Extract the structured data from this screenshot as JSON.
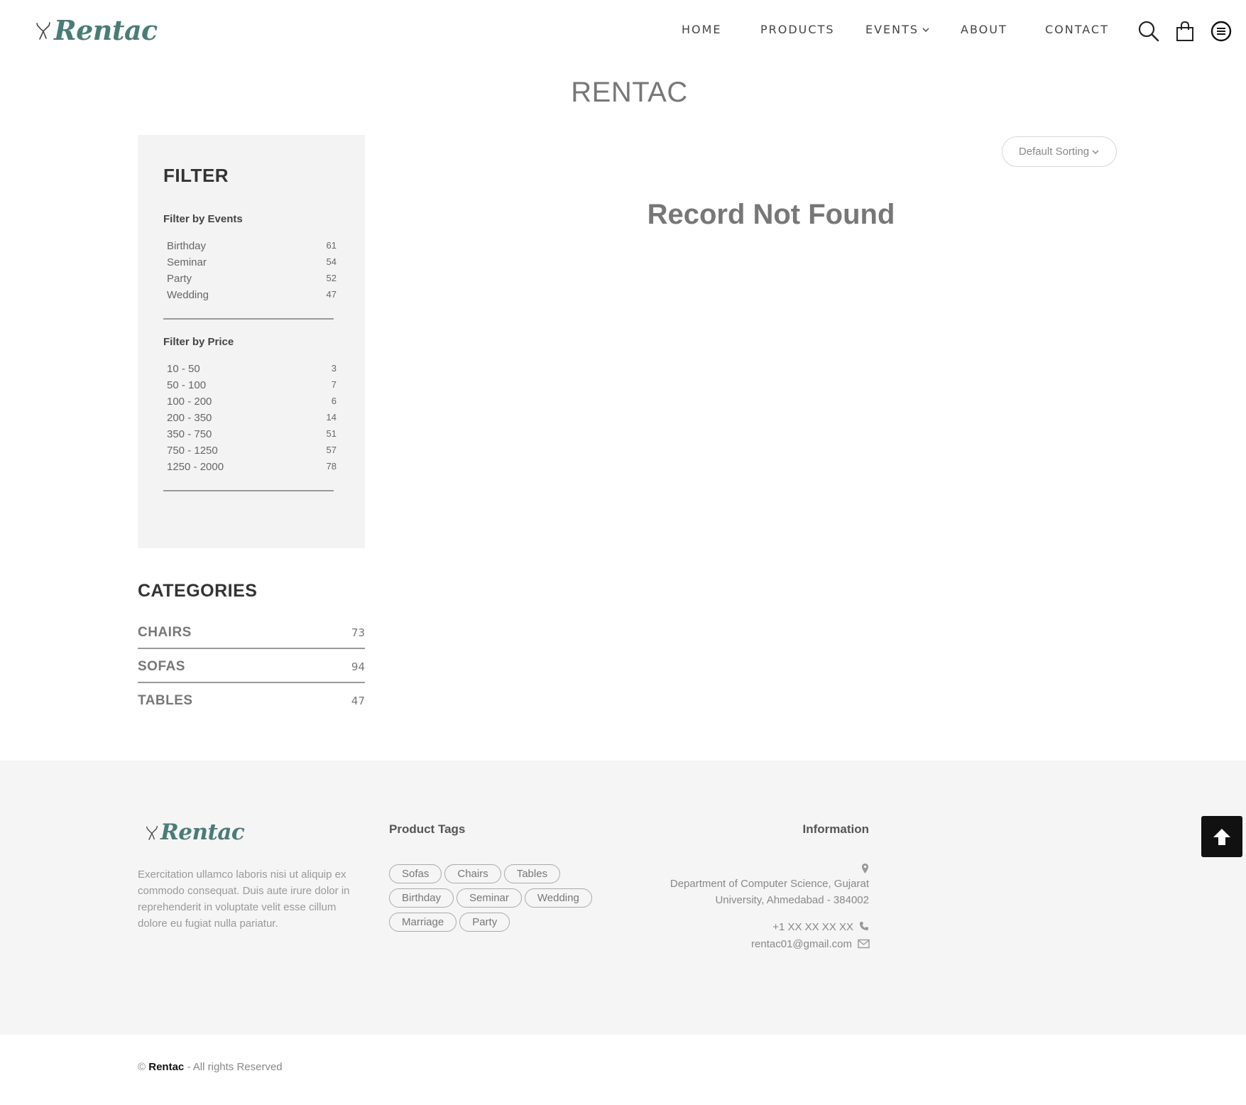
{
  "brand": {
    "name": "Rentac",
    "color": "#4a7c78"
  },
  "nav": {
    "home": "HOME",
    "products": "PRODUCTS",
    "events": "EVENTS",
    "about": "ABOUT",
    "contact": "CONTACT",
    "icons": [
      "search-icon",
      "shopping-bag-icon",
      "menu-icon"
    ]
  },
  "page": {
    "title": "RENTAC",
    "sort_label": "Default Sorting",
    "empty_message": "Record Not Found"
  },
  "filter": {
    "title": "FILTER",
    "events_title": "Filter by Events",
    "events": [
      {
        "label": "Birthday",
        "count": "61"
      },
      {
        "label": "Seminar",
        "count": "54"
      },
      {
        "label": "Party",
        "count": "52"
      },
      {
        "label": "Wedding",
        "count": "47"
      }
    ],
    "price_title": "Filter by Price",
    "prices": [
      {
        "label": "10 - 50",
        "count": "3"
      },
      {
        "label": "50 - 100",
        "count": "7"
      },
      {
        "label": "100 - 200",
        "count": "6"
      },
      {
        "label": "200 - 350",
        "count": "14"
      },
      {
        "label": "350 - 750",
        "count": "51"
      },
      {
        "label": "750 - 1250",
        "count": "57"
      },
      {
        "label": "1250 - 2000",
        "count": "78"
      }
    ]
  },
  "categories": {
    "title": "CATEGORIES",
    "items": [
      {
        "label": "CHAIRS",
        "count": "73"
      },
      {
        "label": "SOFAS",
        "count": "94"
      },
      {
        "label": "TABLES",
        "count": "47"
      }
    ]
  },
  "footer": {
    "description": "Exercitation ullamco laboris nisi ut aliquip ex commodo consequat. Duis aute irure dolor in reprehenderit in voluptate velit esse cillum dolore eu fugiat nulla pariatur.",
    "tags_title": "Product Tags",
    "tags": [
      "Sofas",
      "Chairs",
      "Tables",
      "Birthday",
      "Seminar",
      "Wedding",
      "Marriage",
      "Party"
    ],
    "info_title": "Information",
    "address_line1": "Department of Computer Science, Gujarat",
    "address_line2": "University, Ahmedabad - 384002",
    "phone": "+1 XX XX XX XX",
    "email": "rentac01@gmail.com",
    "copyright_symbol": "©",
    "copyright_brand": "Rentac",
    "copyright_rest": "- All rights Reserved"
  }
}
